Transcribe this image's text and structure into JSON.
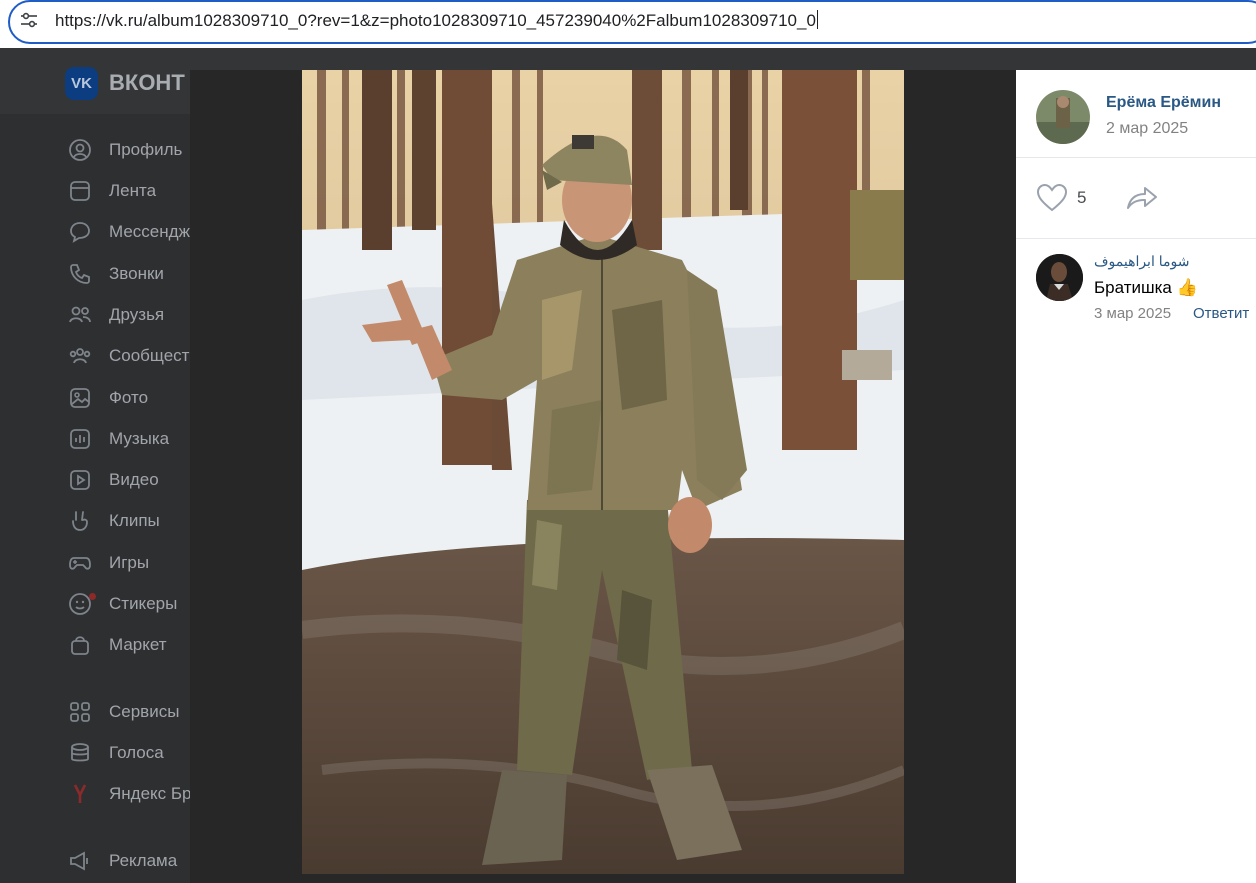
{
  "browser": {
    "url": "https://vk.ru/album1028309710_0?rev=1&z=photo1028309710_457239040%2Falbum1028309710_0"
  },
  "vk": {
    "logo_text": "VK",
    "brand": "ВКОНТ",
    "nav": [
      {
        "label": "Профиль",
        "icon": "profile-icon"
      },
      {
        "label": "Лента",
        "icon": "feed-icon"
      },
      {
        "label": "Мессендж",
        "icon": "messenger-icon"
      },
      {
        "label": "Звонки",
        "icon": "phone-icon"
      },
      {
        "label": "Друзья",
        "icon": "friends-icon"
      },
      {
        "label": "Сообщест",
        "icon": "communities-icon"
      },
      {
        "label": "Фото",
        "icon": "photo-icon"
      },
      {
        "label": "Музыка",
        "icon": "music-icon"
      },
      {
        "label": "Видео",
        "icon": "video-icon"
      },
      {
        "label": "Клипы",
        "icon": "clips-icon"
      },
      {
        "label": "Игры",
        "icon": "games-icon"
      },
      {
        "label": "Стикеры",
        "icon": "stickers-icon"
      },
      {
        "label": "Маркет",
        "icon": "market-icon"
      },
      {
        "label": "Сервисы",
        "icon": "services-icon"
      },
      {
        "label": "Голоса",
        "icon": "votes-icon"
      },
      {
        "label": "Яндекс Бр",
        "icon": "yandex-icon"
      },
      {
        "label": "Реклама",
        "icon": "ads-icon"
      }
    ]
  },
  "viewer": {
    "author_name": "Ерёма Ерёмин",
    "post_date": "2 мар 2025",
    "likes": "5",
    "comment": {
      "author": "شوما ابراهیموف",
      "text": "Братишка",
      "emoji": "👍",
      "date": "3 мар 2025",
      "reply_label": "Ответит"
    }
  },
  "colors": {
    "link_blue": "#2a5885",
    "focus_blue": "#1f5cc6"
  }
}
